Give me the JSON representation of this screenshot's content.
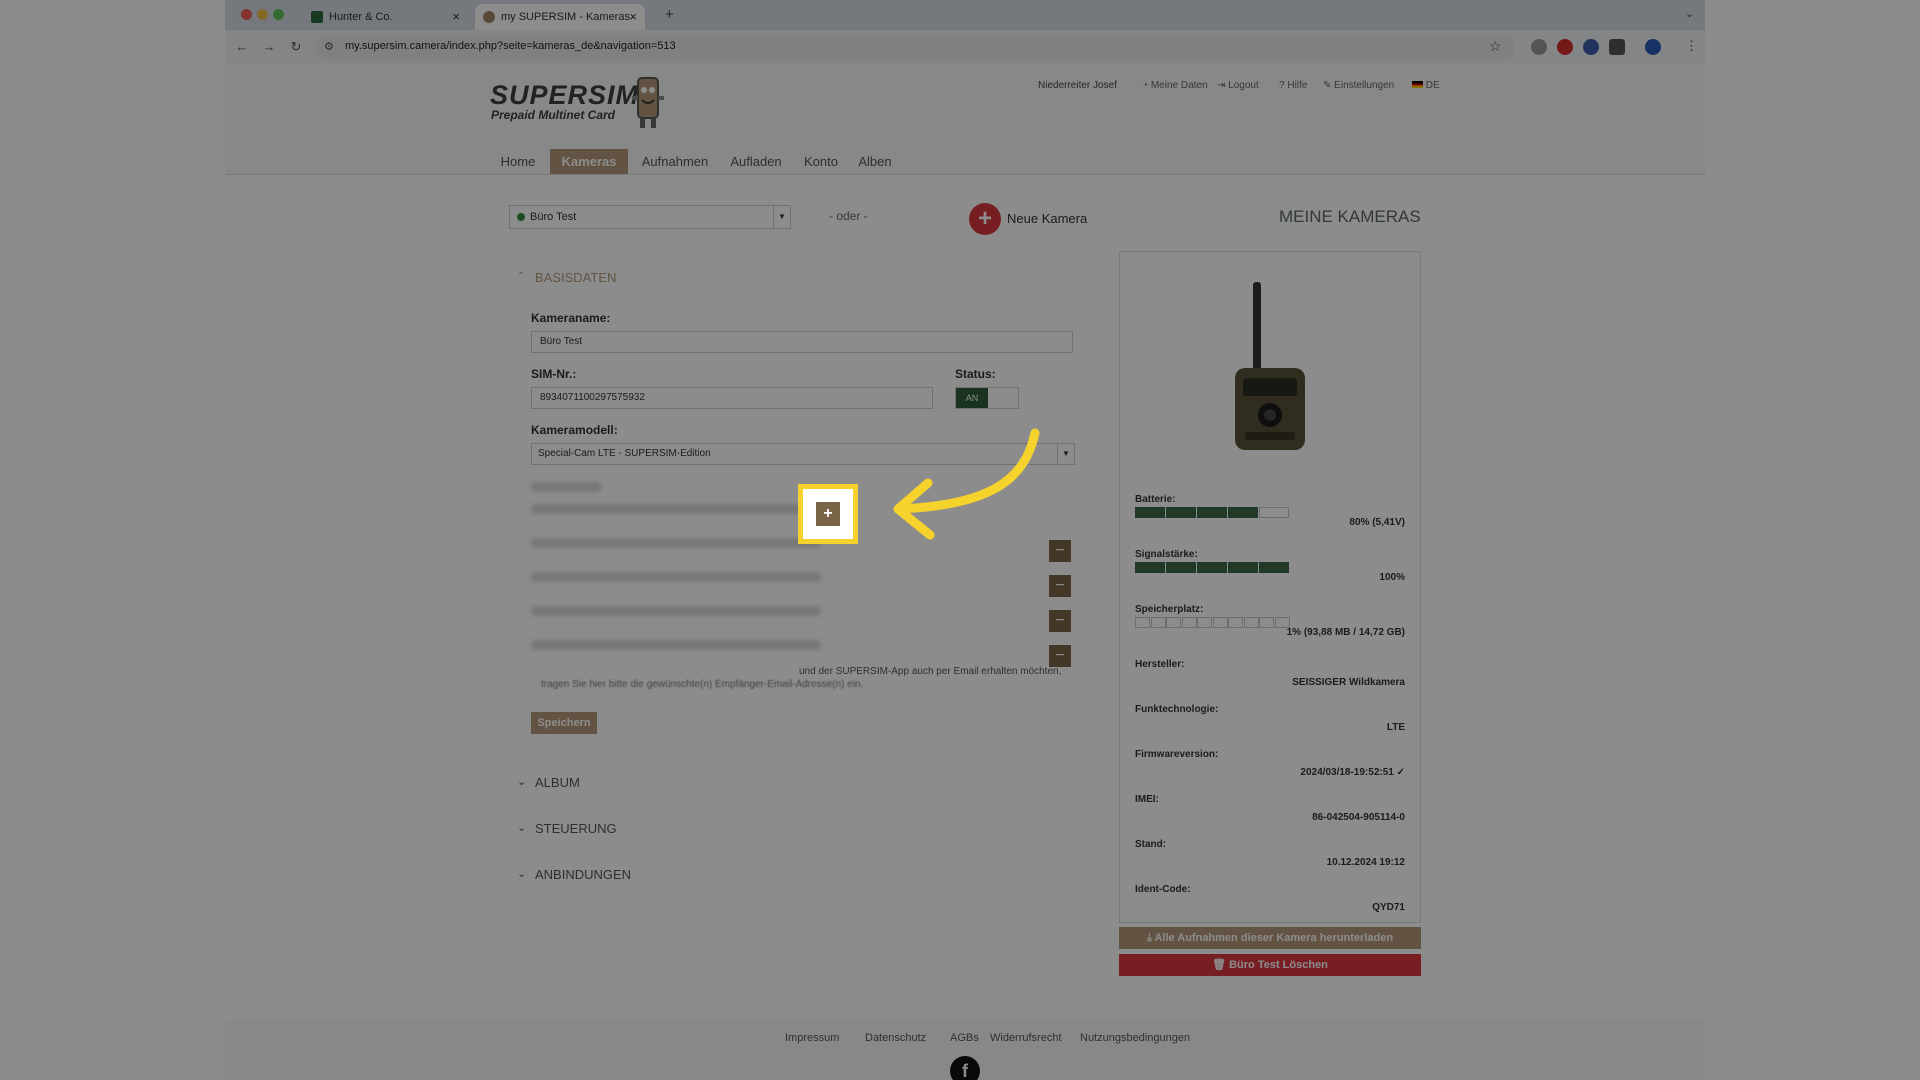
{
  "browser": {
    "tabs": [
      {
        "title": "Hunter & Co."
      },
      {
        "title": "my SUPERSIM - Kameras"
      }
    ],
    "url": "my.supersim.camera/index.php?seite=kameras_de&navigation=513"
  },
  "header": {
    "logo_main": "SUPERSIM",
    "logo_sub": "Prepaid Multinet Card",
    "user": "Niederreiter Josef",
    "links": [
      "Meine Daten",
      "Logout",
      "Hilfe",
      "Einstellungen",
      "DE"
    ],
    "menu": [
      "Home",
      "Kameras",
      "Aufnahmen",
      "Aufladen",
      "Konto",
      "Alben"
    ]
  },
  "toolbar": {
    "camera_select": "Büro Test",
    "oder": "- oder -",
    "new_camera": "Neue Kamera",
    "title": "MEINE KAMERAS"
  },
  "basisdaten": {
    "section": "BASISDATEN",
    "name_label": "Kameraname:",
    "name_value": "Büro Test",
    "sim_label": "SIM-Nr.:",
    "sim_value": "8934071100297575932",
    "status_label": "Status:",
    "status_value": "AN",
    "model_label": "Kameramodell:",
    "model_value": "Special-Cam LTE - SUPERSIM-Edition",
    "email_hint_1": "und der SUPERSIM-App auch per Email erhalten möchten,",
    "email_hint_2": "tragen Sie hier bitte die gewünschte(n) Empfänger-Email-Adresse(n) ein.",
    "save": "Speichern",
    "add_icon": "+",
    "remove_icon": "−"
  },
  "sections": [
    "ALBUM",
    "STEUERUNG",
    "ANBINDUNGEN"
  ],
  "panel": {
    "battery_label": "Batterie:",
    "battery_value": "80% (5,41V)",
    "battery_level": 0.8,
    "signal_label": "Signalstärke:",
    "signal_value": "100%",
    "signal_level": 1.0,
    "storage_label": "Speicherplatz:",
    "storage_value": "1% (93,88 MB / 14,72 GB)",
    "storage_level": 0.01,
    "manufacturer_label": "Hersteller:",
    "manufacturer_value": "SEISSIGER Wildkamera",
    "tech_label": "Funktechnologie:",
    "tech_value": "LTE",
    "firmware_label": "Firmwareversion:",
    "firmware_value": "2024/03/18-19:52:51 ✓",
    "imei_label": "IMEI:",
    "imei_value": "86-042504-905114-0",
    "stand_label": "Stand:",
    "stand_value": "10.12.2024 19:12",
    "ident_label": "Ident-Code:",
    "ident_value": "QYD71",
    "download_btn": "⤓ Alle Aufnahmen dieser Kamera herunterladen",
    "delete_btn": "🗑 Büro Test Löschen"
  },
  "footer": {
    "links": [
      "Impressum",
      "Datenschutz",
      "AGBs",
      "Widerrufsrecht",
      "Nutzungsbedingungen"
    ],
    "facebook": "f"
  },
  "colors": {
    "accent": "#b5977a",
    "danger": "#d9373f",
    "highlight": "#f6d22d",
    "status_on": "#2f5e3b"
  }
}
